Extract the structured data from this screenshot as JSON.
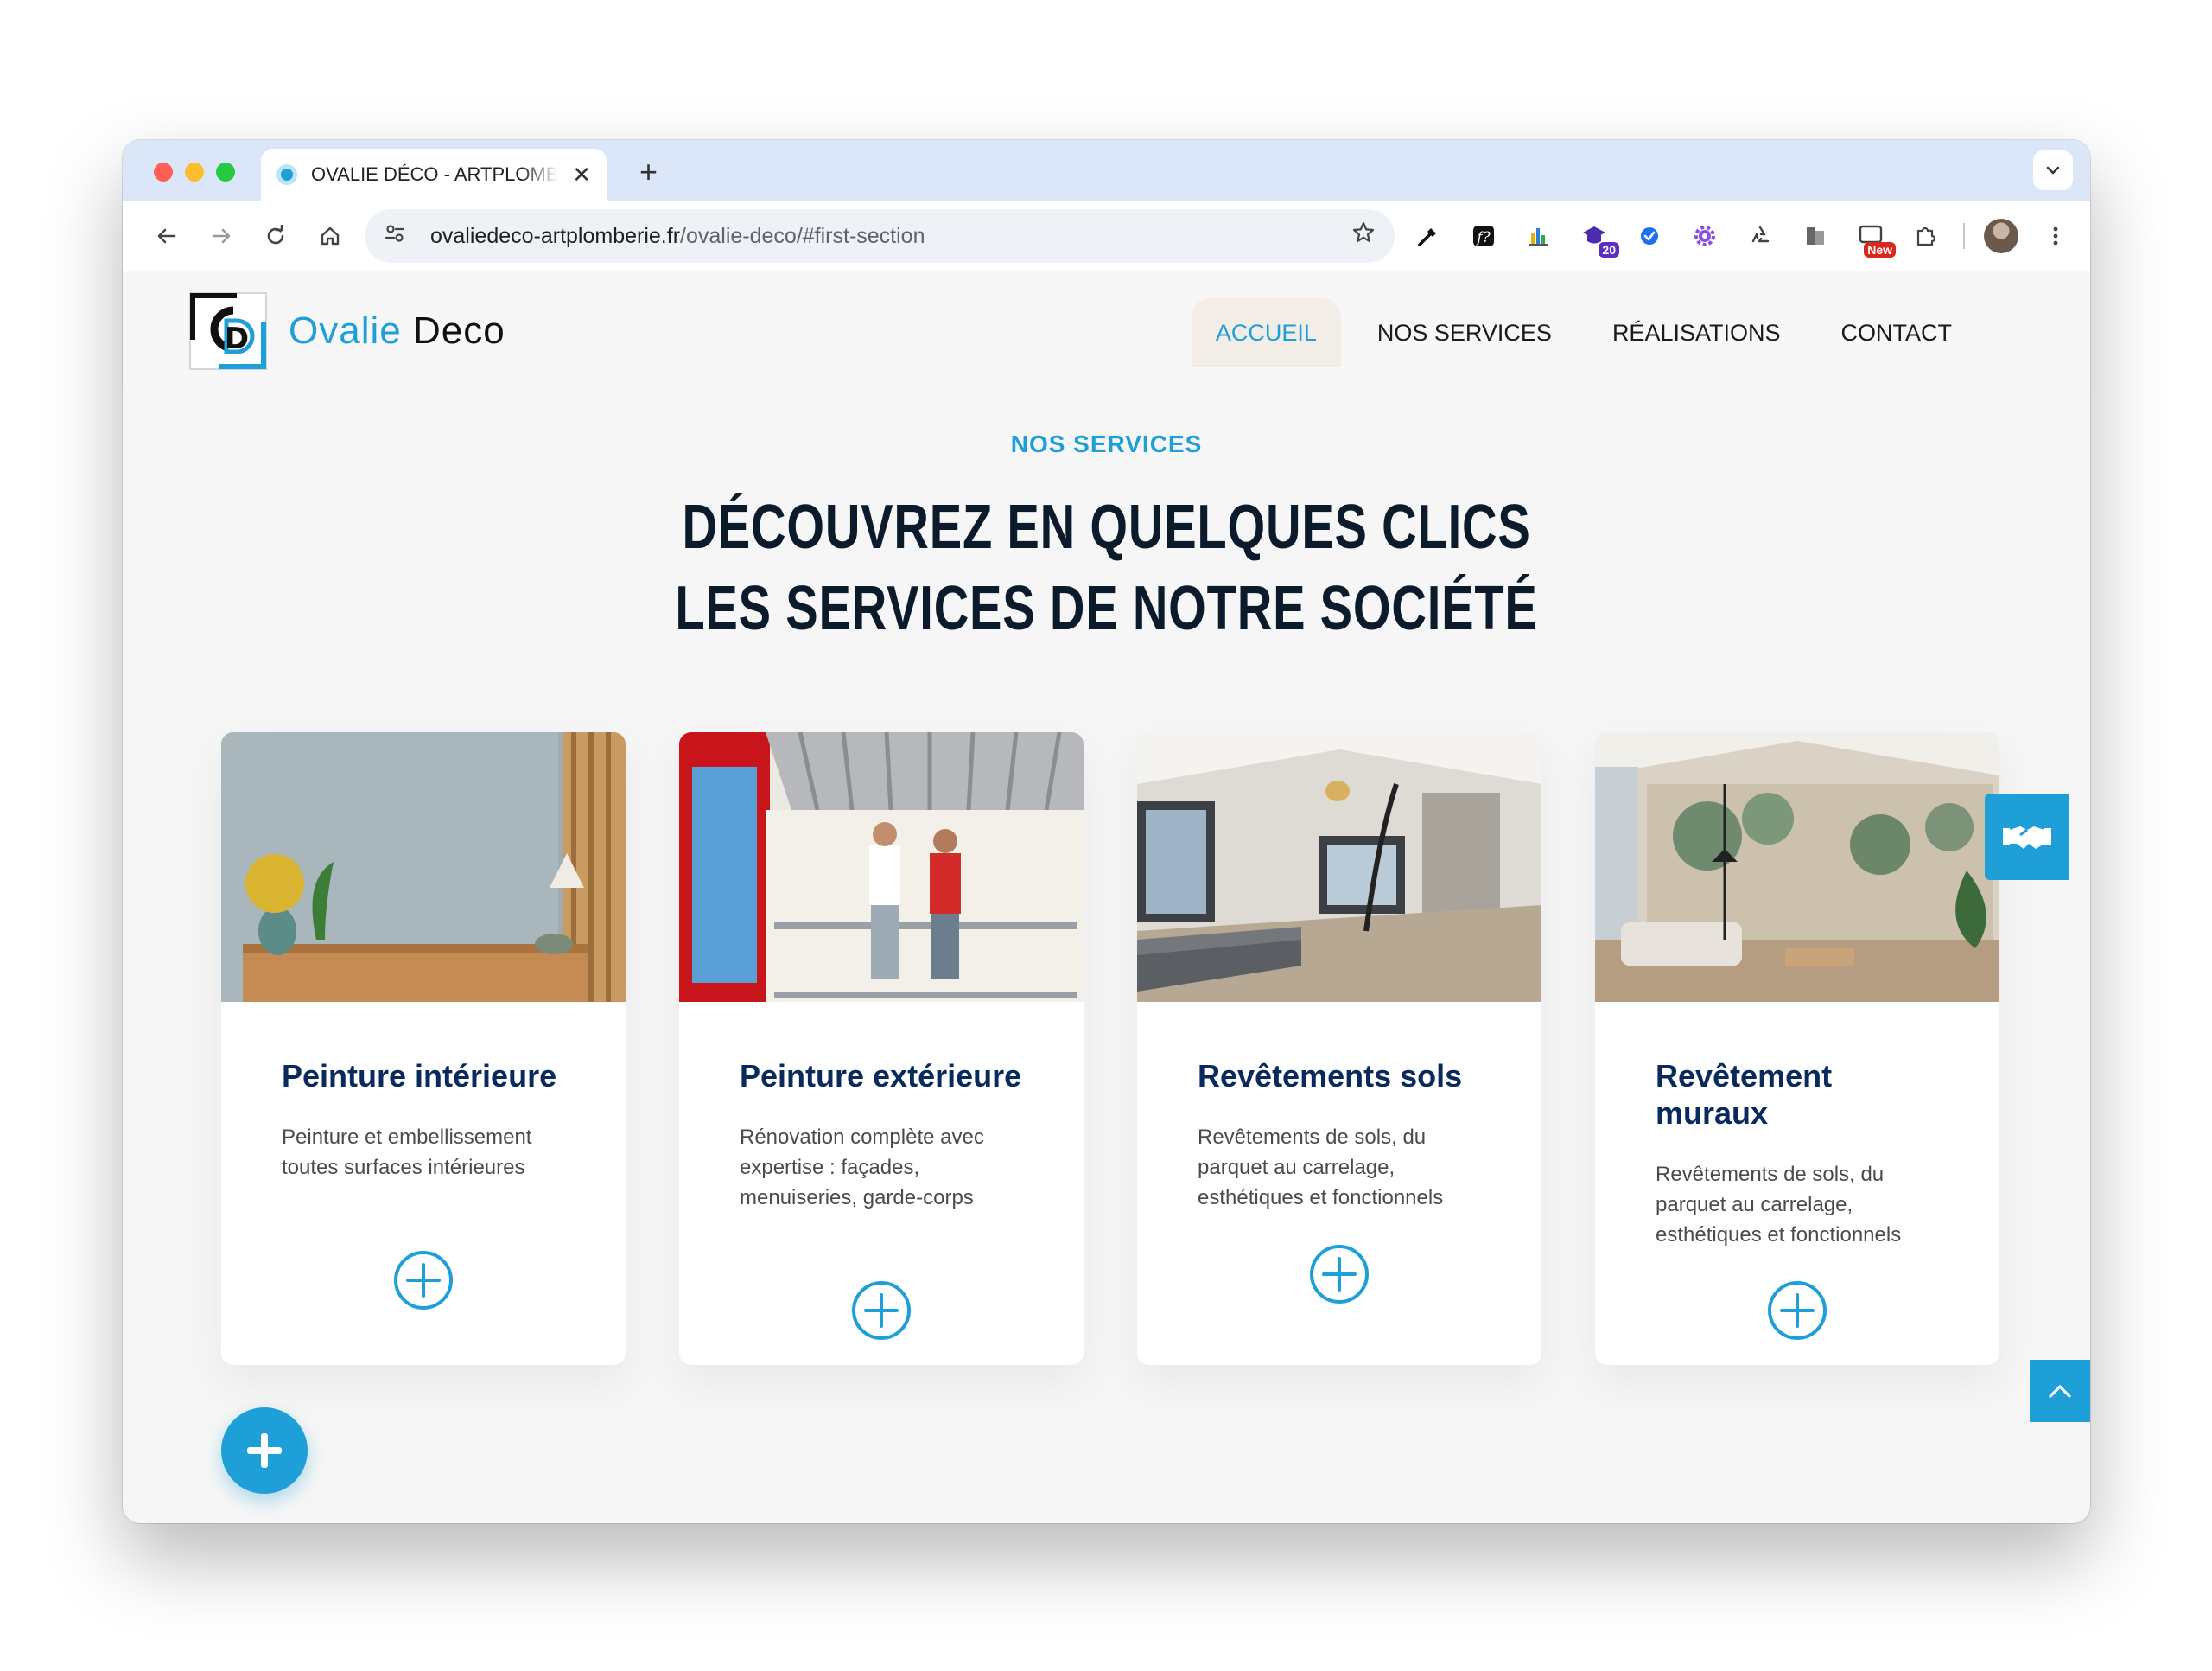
{
  "browser": {
    "tab_title": "OVALIE DÉCO - ARTPLOMBERIE",
    "tab_close": "✕",
    "new_tab": "+",
    "url_host": "ovaliedeco-artplomberie.fr",
    "url_path": "/ovalie-deco/#first-section",
    "ext_badges": {
      "count": "20",
      "new": "New"
    }
  },
  "site": {
    "logo": {
      "word1": "Ovalie",
      "word2": "Deco"
    },
    "menu": [
      {
        "label": "ACCUEIL",
        "active": true
      },
      {
        "label": "NOS SERVICES",
        "active": false
      },
      {
        "label": "RÉALISATIONS",
        "active": false
      },
      {
        "label": "CONTACT",
        "active": false
      }
    ]
  },
  "section": {
    "eyebrow": "NOS SERVICES",
    "headline": [
      "DÉCOUVREZ EN QUELQUES CLICS",
      "LES SERVICES DE NOTRE SOCIÉTÉ"
    ]
  },
  "cards": [
    {
      "title": "Peinture intérieure",
      "desc": "Peinture et embellissement toutes surfaces intérieures"
    },
    {
      "title": "Peinture extérieure",
      "desc": "Rénovation complète avec expertise : façades, menuiseries, garde-corps"
    },
    {
      "title": "Revêtements sols",
      "desc": "Revêtements de sols, du parquet au carrelage, esthétiques et fonctionnels"
    },
    {
      "title": "Revêtement muraux",
      "desc": "Revêtements de sols, du parquet au carrelage, esthétiques et fonctionnels"
    }
  ],
  "colors": {
    "accent": "#1e9fd8",
    "navy": "#0a2a5e",
    "headline": "#0c1b2c"
  }
}
